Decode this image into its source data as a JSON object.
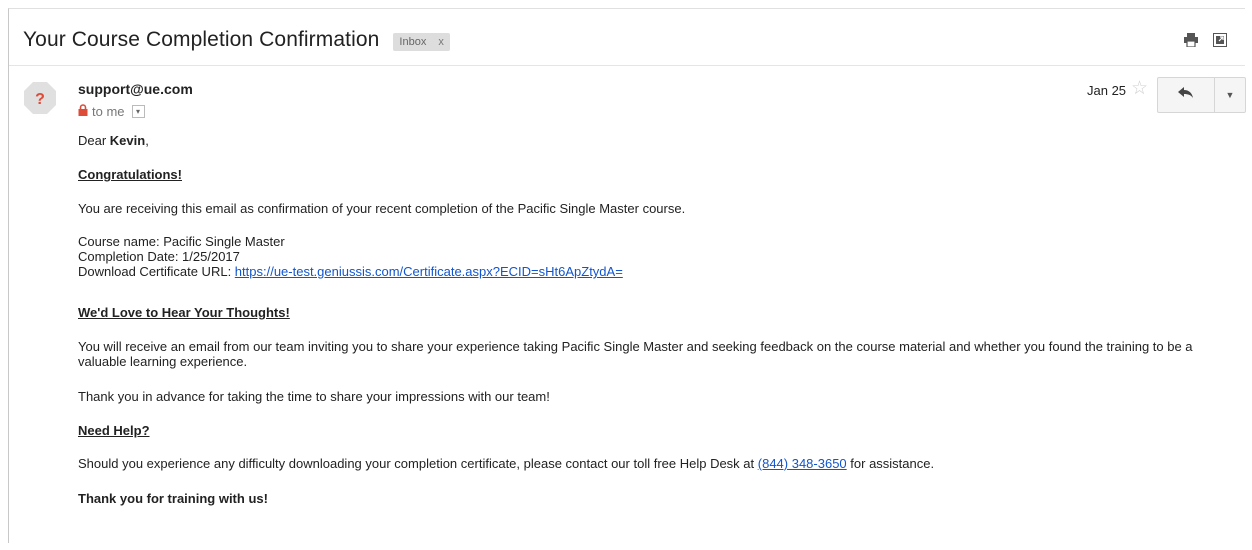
{
  "email": {
    "subject": "Your Course Completion Confirmation",
    "label": "Inbox",
    "label_close": "x",
    "sender": "support@ue.com",
    "avatar_glyph": "?",
    "recipient": "to me",
    "date": "Jan 25"
  },
  "icons": {
    "print": "print-icon",
    "new_window": "new-window-icon",
    "star": "star-icon",
    "reply": "reply-icon",
    "more": "dropdown-icon",
    "lock": "lock-icon"
  },
  "body": {
    "greeting_prefix": "Dear ",
    "greeting_name": "Kevin",
    "greeting_suffix": ",",
    "heading_congrats": "Congratulations!",
    "intro": "You are receiving this email as confirmation of your recent completion of the Pacific Single Master course.",
    "course_name": "Course name: Pacific Single Master",
    "completion_date": "Completion Date: 1/25/2017",
    "certificate_label": "Download Certificate URL: ",
    "certificate_url": "https://ue-test.geniussis.com/Certificate.aspx?ECID=sHt6ApZtydA=",
    "heading_thoughts": "We'd Love to Hear Your Thoughts!",
    "receive": "You will receive an email from our team inviting you to share your experience taking Pacific Single Master and seeking feedback on the course material and whether you found the training to be a valuable learning experience.",
    "thanks_advance": "Thank you in advance for taking the time to share your impressions with our team!",
    "heading_help": "Need Help?",
    "difficulty_prefix": "Should you experience any difficulty downloading your completion certificate, please contact our toll free Help Desk at ",
    "phone": "(844) 348-3650",
    "difficulty_suffix": " for assistance.",
    "closing": "Thank you for training with us!"
  },
  "colors": {
    "link": "#1155cc",
    "lock": "#dd4b39",
    "avatar_bg": "#e0e0e0",
    "avatar_glyph": "#dd4b39"
  }
}
